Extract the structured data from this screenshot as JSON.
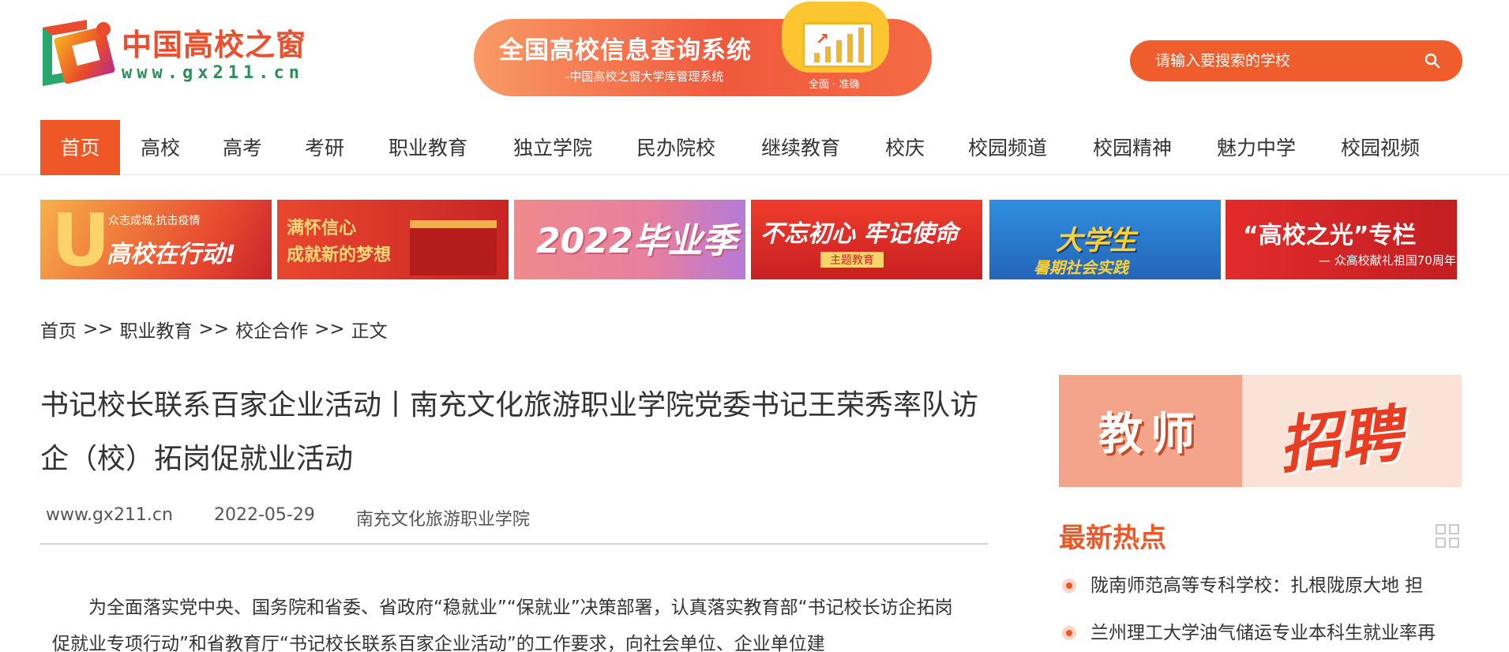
{
  "logo": {
    "name": "中国高校之窗",
    "url": "www.gx211.cn"
  },
  "banner": {
    "title": "全国高校信息查询系统",
    "subtitle": "-中国高校之窗大学库管理系统",
    "tag": "全面 · 准确"
  },
  "search": {
    "placeholder": "请输入要搜索的学校"
  },
  "nav": [
    "首页",
    "高校",
    "高考",
    "考研",
    "职业教育",
    "独立学院",
    "民办院校",
    "继续教育",
    "校庆",
    "校园频道",
    "校园精神",
    "魅力中学",
    "校园视频"
  ],
  "topics": [
    {
      "main": "高校在行动!",
      "small": "众志成城,抗击疫情",
      "color": "#f0a12c"
    },
    {
      "main": "满怀信心",
      "small": "成就新的梦想",
      "color": "#e54a2e"
    },
    {
      "main": "2022毕业季",
      "small": "",
      "color": "#e27b86"
    },
    {
      "main": "不忘初心 牢记使命",
      "small": "主题教育",
      "color": "#e33a2b"
    },
    {
      "main": "大学生",
      "small": "暑期社会实践",
      "color": "#2f7fd0"
    },
    {
      "main": "“高校之光”专栏",
      "small": "— 众高校献礼祖国70周年",
      "color": "#d92a2b"
    }
  ],
  "breadcrumb": [
    "首页",
    "职业教育",
    "校企合作",
    "正文"
  ],
  "breadcrumb_sep": ">>",
  "article": {
    "title": "书记校长联系百家企业活动丨南充文化旅游职业学院党委书记王荣秀率队访企（校）拓岗促就业活动",
    "source": "www.gx211.cn",
    "date": "2022-05-29",
    "org": "南充文化旅游职业学院",
    "paragraph": "为全面落实党中央、国务院和省委、省政府“稳就业”“保就业”决策部署，认真落实教育部“书记校长访企拓岗促就业专项行动”和省教育厅“书记校长联系百家企业活动”的工作要求，向社会单位、企业单位建"
  },
  "ad": {
    "left": "教师",
    "right": "招聘"
  },
  "hot": {
    "title": "最新热点",
    "items": [
      "陇南师范高等专科学校：扎根陇原大地 担",
      "兰州理工大学油气储运专业本科生就业率再"
    ]
  },
  "colors": {
    "accent": "#ef5727",
    "search": "#ef5d2d"
  }
}
